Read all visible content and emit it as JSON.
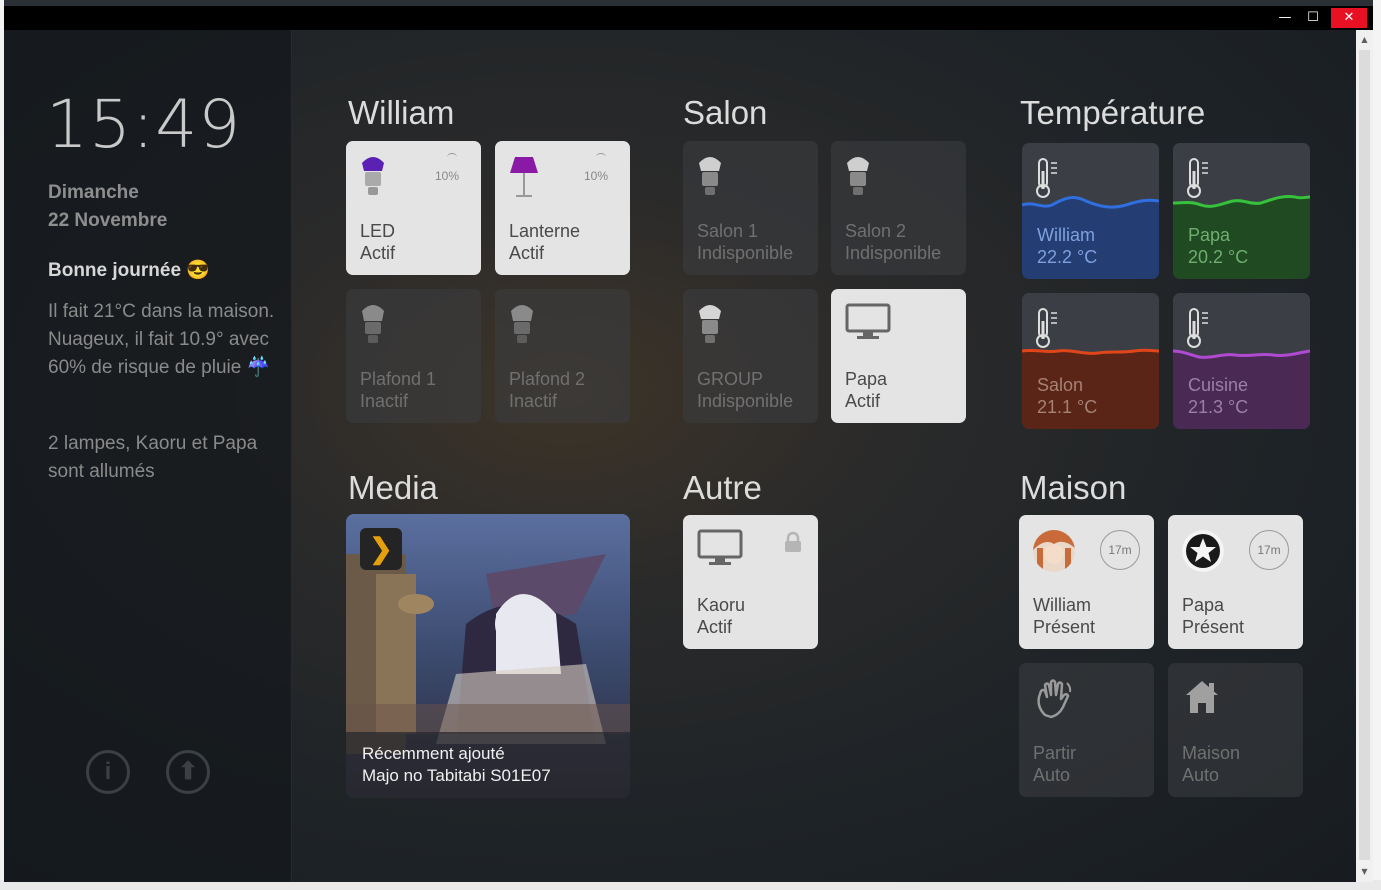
{
  "window": {
    "minimize_label": "—",
    "maximize_label": "☐",
    "close_label": "✕"
  },
  "sidebar": {
    "time": "15:49",
    "day": "Dimanche",
    "date": "22 Novembre",
    "greeting": "Bonne journée 😎",
    "weather": "Il fait 21°C dans la maison. Nuageux, il fait 10.9° avec 60% de risque de pluie ☔",
    "lamps": "2 lampes, Kaoru et Papa sont allumés",
    "info_icon": "i",
    "upload_icon": "⬆"
  },
  "sections": {
    "william": "William",
    "salon": "Salon",
    "temperature": "Température",
    "media": "Media",
    "autre": "Autre",
    "maison": "Maison"
  },
  "william_tiles": [
    {
      "name": "LED",
      "state": "Actif",
      "brightness": "10%",
      "icon": "bulb-icon",
      "color": "#5a21b4"
    },
    {
      "name": "Lanterne",
      "state": "Actif",
      "brightness": "10%",
      "icon": "lamp-icon",
      "color": "#8a1aa6"
    },
    {
      "name": "Plafond 1",
      "state": "Inactif",
      "icon": "bulb-icon"
    },
    {
      "name": "Plafond 2",
      "state": "Inactif",
      "icon": "bulb-icon"
    }
  ],
  "salon_tiles": [
    {
      "name": "Salon 1",
      "state": "Indisponible",
      "icon": "bulb-icon"
    },
    {
      "name": "Salon 2",
      "state": "Indisponible",
      "icon": "bulb-icon"
    },
    {
      "name": "GROUP",
      "state": "Indisponible",
      "icon": "bulb-icon"
    },
    {
      "name": "Papa",
      "state": "Actif",
      "icon": "monitor-icon"
    }
  ],
  "temperature_tiles": [
    {
      "name": "William",
      "value": "22.2 °C",
      "color": "#2f6fe0"
    },
    {
      "name": "Papa",
      "value": "20.2 °C",
      "color": "#36c23a"
    },
    {
      "name": "Salon",
      "value": "21.1 °C",
      "color": "#e0461a"
    },
    {
      "name": "Cuisine",
      "value": "21.3 °C",
      "color": "#b04ad0"
    }
  ],
  "media": {
    "caption_line1": "Récemment ajouté",
    "caption_line2": "Majo no Tabitabi S01E07",
    "badge_icon": "❯"
  },
  "autre_tiles": [
    {
      "name": "Kaoru",
      "state": "Actif",
      "icon": "monitor-icon"
    }
  ],
  "maison_tiles": [
    {
      "name": "William",
      "state": "Présent",
      "badge": "17m",
      "icon": "avatar"
    },
    {
      "name": "Papa",
      "state": "Présent",
      "badge": "17m",
      "icon": "avatar"
    },
    {
      "name": "Partir",
      "state": "Auto",
      "icon": "wave-hand-icon"
    },
    {
      "name": "Maison",
      "state": "Auto",
      "icon": "home-icon"
    }
  ]
}
